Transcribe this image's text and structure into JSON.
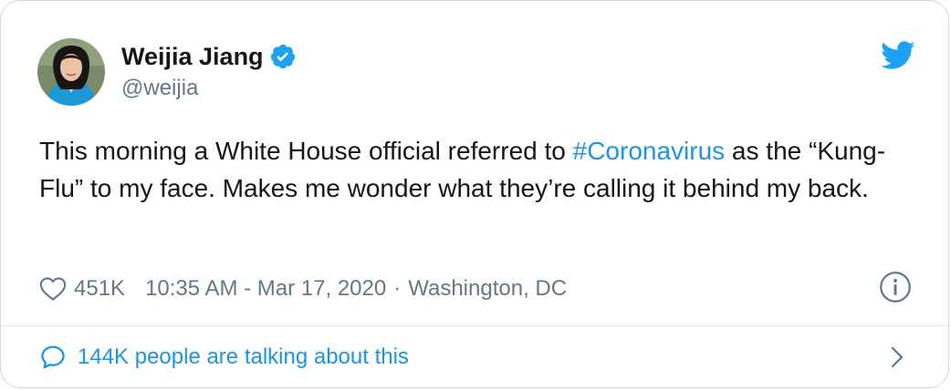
{
  "user": {
    "display_name": "Weijia Jiang",
    "handle": "@weijia",
    "verified": true,
    "avatar": "avatar-photo"
  },
  "tweet": {
    "text_before": "This morning a White House official referred to ",
    "hashtag": "#Coronavirus",
    "text_after": " as the “Kung-Flu” to my face. Makes me wonder what they’re calling it behind my back."
  },
  "meta": {
    "likes": "451K",
    "timestamp": "10:35 AM - Mar 17, 2020",
    "separator": "·",
    "location": "Washington, DC"
  },
  "footer": {
    "talking_text": "144K people are talking about this"
  },
  "icons": {
    "brand": "twitter-bird-icon",
    "verified": "verified-badge-icon",
    "like": "heart-icon",
    "info": "info-icon",
    "reply": "speech-bubble-icon",
    "chevron": "chevron-right-icon"
  },
  "colors": {
    "twitter_blue": "#1da1f2",
    "link_blue": "#1b95e0",
    "text_primary": "#14171a",
    "text_secondary": "#657786",
    "border": "#cfd9de"
  }
}
